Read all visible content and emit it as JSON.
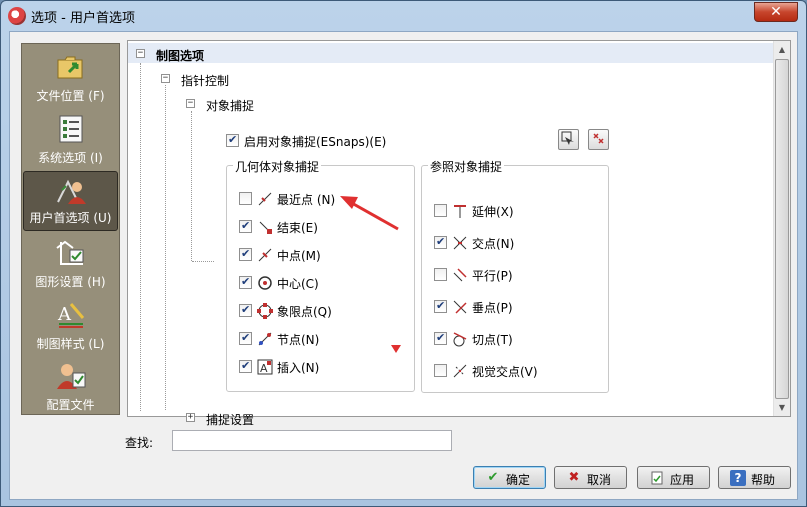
{
  "window": {
    "title": "选项 - 用户首选项",
    "close_glyph": "✕"
  },
  "sidebar": {
    "items": [
      {
        "label": "文件位置 (F)"
      },
      {
        "label": "系统选项 (I)"
      },
      {
        "label": "用户首选项 (U)"
      },
      {
        "label": "图形设置 (H)"
      },
      {
        "label": "制图样式 (L)"
      },
      {
        "label": "配置文件"
      }
    ],
    "selected_index": 2
  },
  "tree": {
    "root": "制图选项",
    "pointer_control": "指针控制",
    "object_snap": "对象捕捉",
    "snap_settings": "捕捉设置",
    "enable_snap": {
      "label": "启用对象捕捉(ESnaps)(E)",
      "checked": true
    },
    "geometry_group": {
      "title": "几何体对象捕捉",
      "items": [
        {
          "label": "最近点 (N)",
          "checked": false
        },
        {
          "label": "结束(E)",
          "checked": true
        },
        {
          "label": "中点(M)",
          "checked": true
        },
        {
          "label": "中心(C)",
          "checked": true
        },
        {
          "label": "象限点(Q)",
          "checked": true
        },
        {
          "label": "节点(N)",
          "checked": true
        },
        {
          "label": "插入(N)",
          "checked": true
        }
      ]
    },
    "reference_group": {
      "title": "参照对象捕捉",
      "items": [
        {
          "label": "延伸(X)",
          "checked": false
        },
        {
          "label": "交点(N)",
          "checked": true
        },
        {
          "label": "平行(P)",
          "checked": false
        },
        {
          "label": "垂点(P)",
          "checked": true
        },
        {
          "label": "切点(T)",
          "checked": true
        },
        {
          "label": "视觉交点(V)",
          "checked": false
        }
      ]
    }
  },
  "find": {
    "label": "查找:",
    "value": ""
  },
  "buttons": {
    "ok": "确定",
    "cancel": "取消",
    "apply": "应用",
    "help": "帮助"
  },
  "colors": {
    "annotation_red": "#e03030",
    "sidebar_bg": "#968f7a",
    "sidebar_selected": "#5d5749"
  }
}
